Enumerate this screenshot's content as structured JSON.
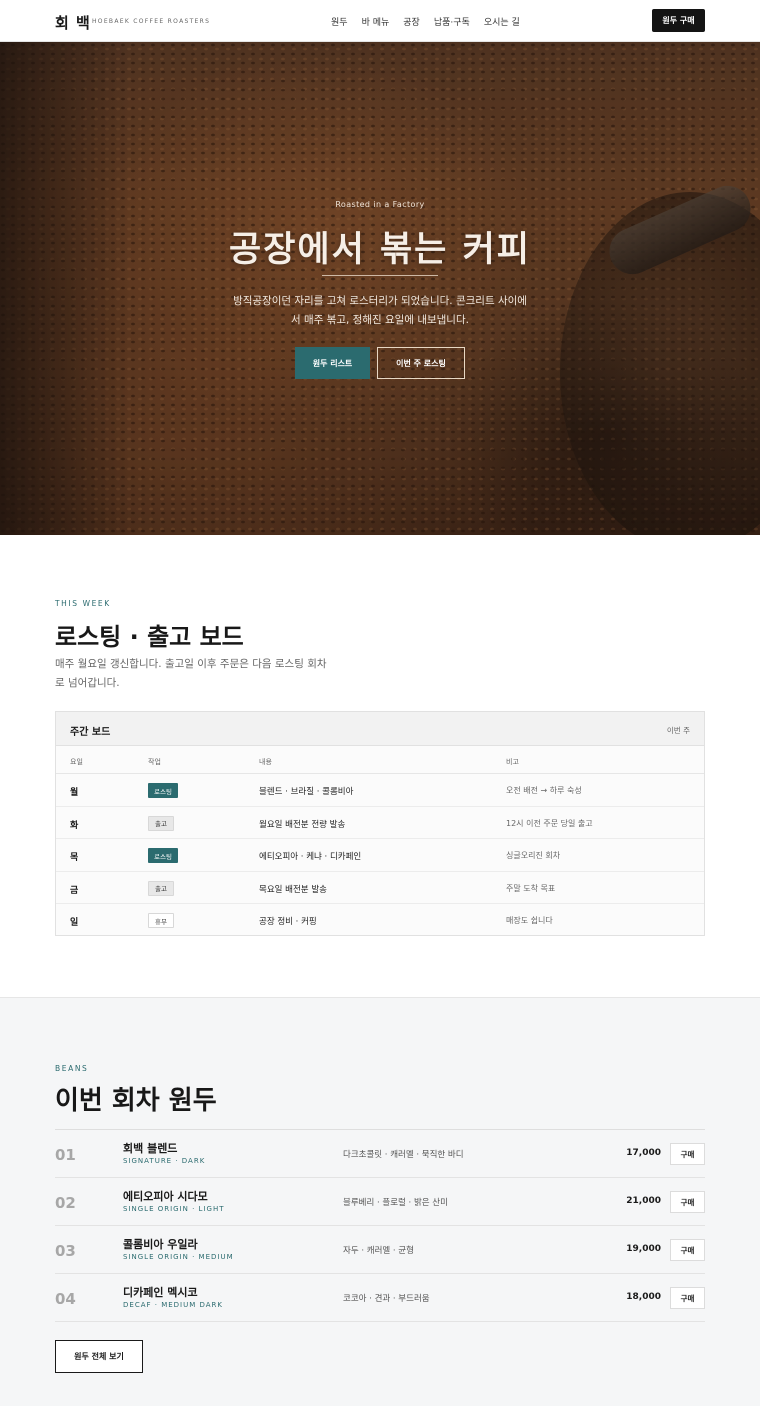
{
  "header": {
    "logo": "회 백",
    "logo_sub": "HOEBAEK COFFEE ROASTERS",
    "nav": [
      "원두",
      "바 메뉴",
      "공장",
      "납품·구독",
      "오시는 길"
    ],
    "buy_label": "원두 구매"
  },
  "hero": {
    "eyebrow": "Roasted in a Factory",
    "title": "공장에서 볶는 커피",
    "desc": "방직공장이던 자리를 고쳐 로스터리가 되었습니다. 콘크리트 사이에서 매주 볶고, 정해진 요일에 내보냅니다.",
    "primary_label": "원두 리스트",
    "secondary_label": "이번 주 로스팅"
  },
  "board_section": {
    "eyebrow": "THIS WEEK",
    "title": "로스팅 · 출고 보드",
    "desc": "매주 월요일 갱신합니다. 출고일 이후 주문은 다음 로스팅 회차로 넘어갑니다.",
    "board_title": "주간 보드",
    "board_week": "이번 주",
    "columns": [
      "요일",
      "작업",
      "내용",
      "비고"
    ],
    "rows": [
      {
        "day": "월",
        "task": "로스팅",
        "kind": "roast",
        "content": "블렌드 · 브라질 · 콜롬비아",
        "note": "오전 배전 → 하루 숙성"
      },
      {
        "day": "화",
        "task": "출고",
        "kind": "ship",
        "content": "월요일 배전분 전량 발송",
        "note": "12시 이전 주문 당일 출고"
      },
      {
        "day": "목",
        "task": "로스팅",
        "kind": "roast",
        "content": "에티오피아 · 케냐 · 디카페인",
        "note": "싱글오리진 회차"
      },
      {
        "day": "금",
        "task": "출고",
        "kind": "ship",
        "content": "목요일 배전분 발송",
        "note": "주말 도착 목표"
      },
      {
        "day": "일",
        "task": "휴무",
        "kind": "rest",
        "content": "공장 정비 · 커핑",
        "note": "매장도 쉽니다"
      }
    ]
  },
  "beans_section": {
    "eyebrow": "BEANS",
    "title": "이번 회차 원두",
    "items": [
      {
        "num": "01",
        "name": "회백 블렌드",
        "origin": "SIGNATURE · DARK",
        "notes": "다크초콜릿 · 캐러멜 · 묵직한 바디",
        "price": "17,000",
        "buy": "구매"
      },
      {
        "num": "02",
        "name": "에티오피아 시다모",
        "origin": "SINGLE ORIGIN · LIGHT",
        "notes": "블루베리 · 플로럴 · 밝은 산미",
        "price": "21,000",
        "buy": "구매"
      },
      {
        "num": "03",
        "name": "콜롬비아 우일라",
        "origin": "SINGLE ORIGIN · MEDIUM",
        "notes": "자두 · 캐러멜 · 균형",
        "price": "19,000",
        "buy": "구매"
      },
      {
        "num": "04",
        "name": "디카페인 멕시코",
        "origin": "DECAF · MEDIUM DARK",
        "notes": "코코아 · 견과 · 부드러움",
        "price": "18,000",
        "buy": "구매"
      }
    ],
    "all_label": "원두 전체 보기"
  }
}
